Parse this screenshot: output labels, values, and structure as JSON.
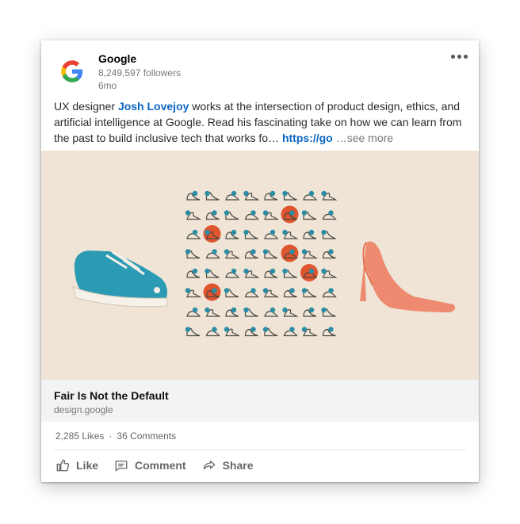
{
  "post": {
    "author": "Google",
    "followers": "8,249,597 followers",
    "age": "6mo",
    "text_before": "UX designer ",
    "mention": "Josh Lovejoy",
    "text_after": " works at the intersection of product design, ethics, and artificial intelligence at Google. Read his fascinating take on how we can learn from the past to build inclusive tech that works fo…",
    "link_text": "https://go",
    "see_more": "…see more"
  },
  "link_preview": {
    "title": "Fair Is Not the Default",
    "domain": "design.google"
  },
  "social": {
    "likes": "2,285 Likes",
    "comments": "36 Comments"
  },
  "actions": {
    "like": "Like",
    "comment": "Comment",
    "share": "Share"
  },
  "colors": {
    "accent": "#0a66c2",
    "teal_shoe": "#2b9bb4",
    "orange": "#e0542e",
    "heel": "#ee8a6f",
    "background_art": "#efe4d6"
  },
  "icons": [
    "google-logo",
    "more-options-icon",
    "thumbs-up-icon",
    "comment-icon",
    "share-icon"
  ]
}
